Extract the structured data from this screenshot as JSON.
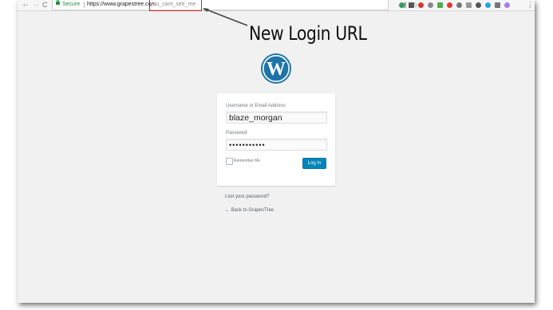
{
  "browser": {
    "back": "←",
    "forward": "→",
    "reload": "C",
    "secure_label": "Secure",
    "url_main": "https://www.grapestree.com",
    "url_tail": "you_cant_see_me",
    "menu": "⋮",
    "extension_colors": [
      "#2e9e5e",
      "#555555",
      "#d33a2c",
      "#888888",
      "#4caf50",
      "#e53935",
      "#777777",
      "#999999",
      "#555555",
      "#29a3e0",
      "#777777",
      "#a97be8"
    ]
  },
  "annotation": {
    "callout": "New Login URL"
  },
  "login": {
    "username_label": "Username or Email Address",
    "username_value": "blaze_morgan",
    "password_label": "Password",
    "password_value": "•••••••••••",
    "remember_label": "Remember Me",
    "login_button": "Log In",
    "lost_password": "Lost your password?",
    "back_link": "← Back to GrapesTree"
  }
}
